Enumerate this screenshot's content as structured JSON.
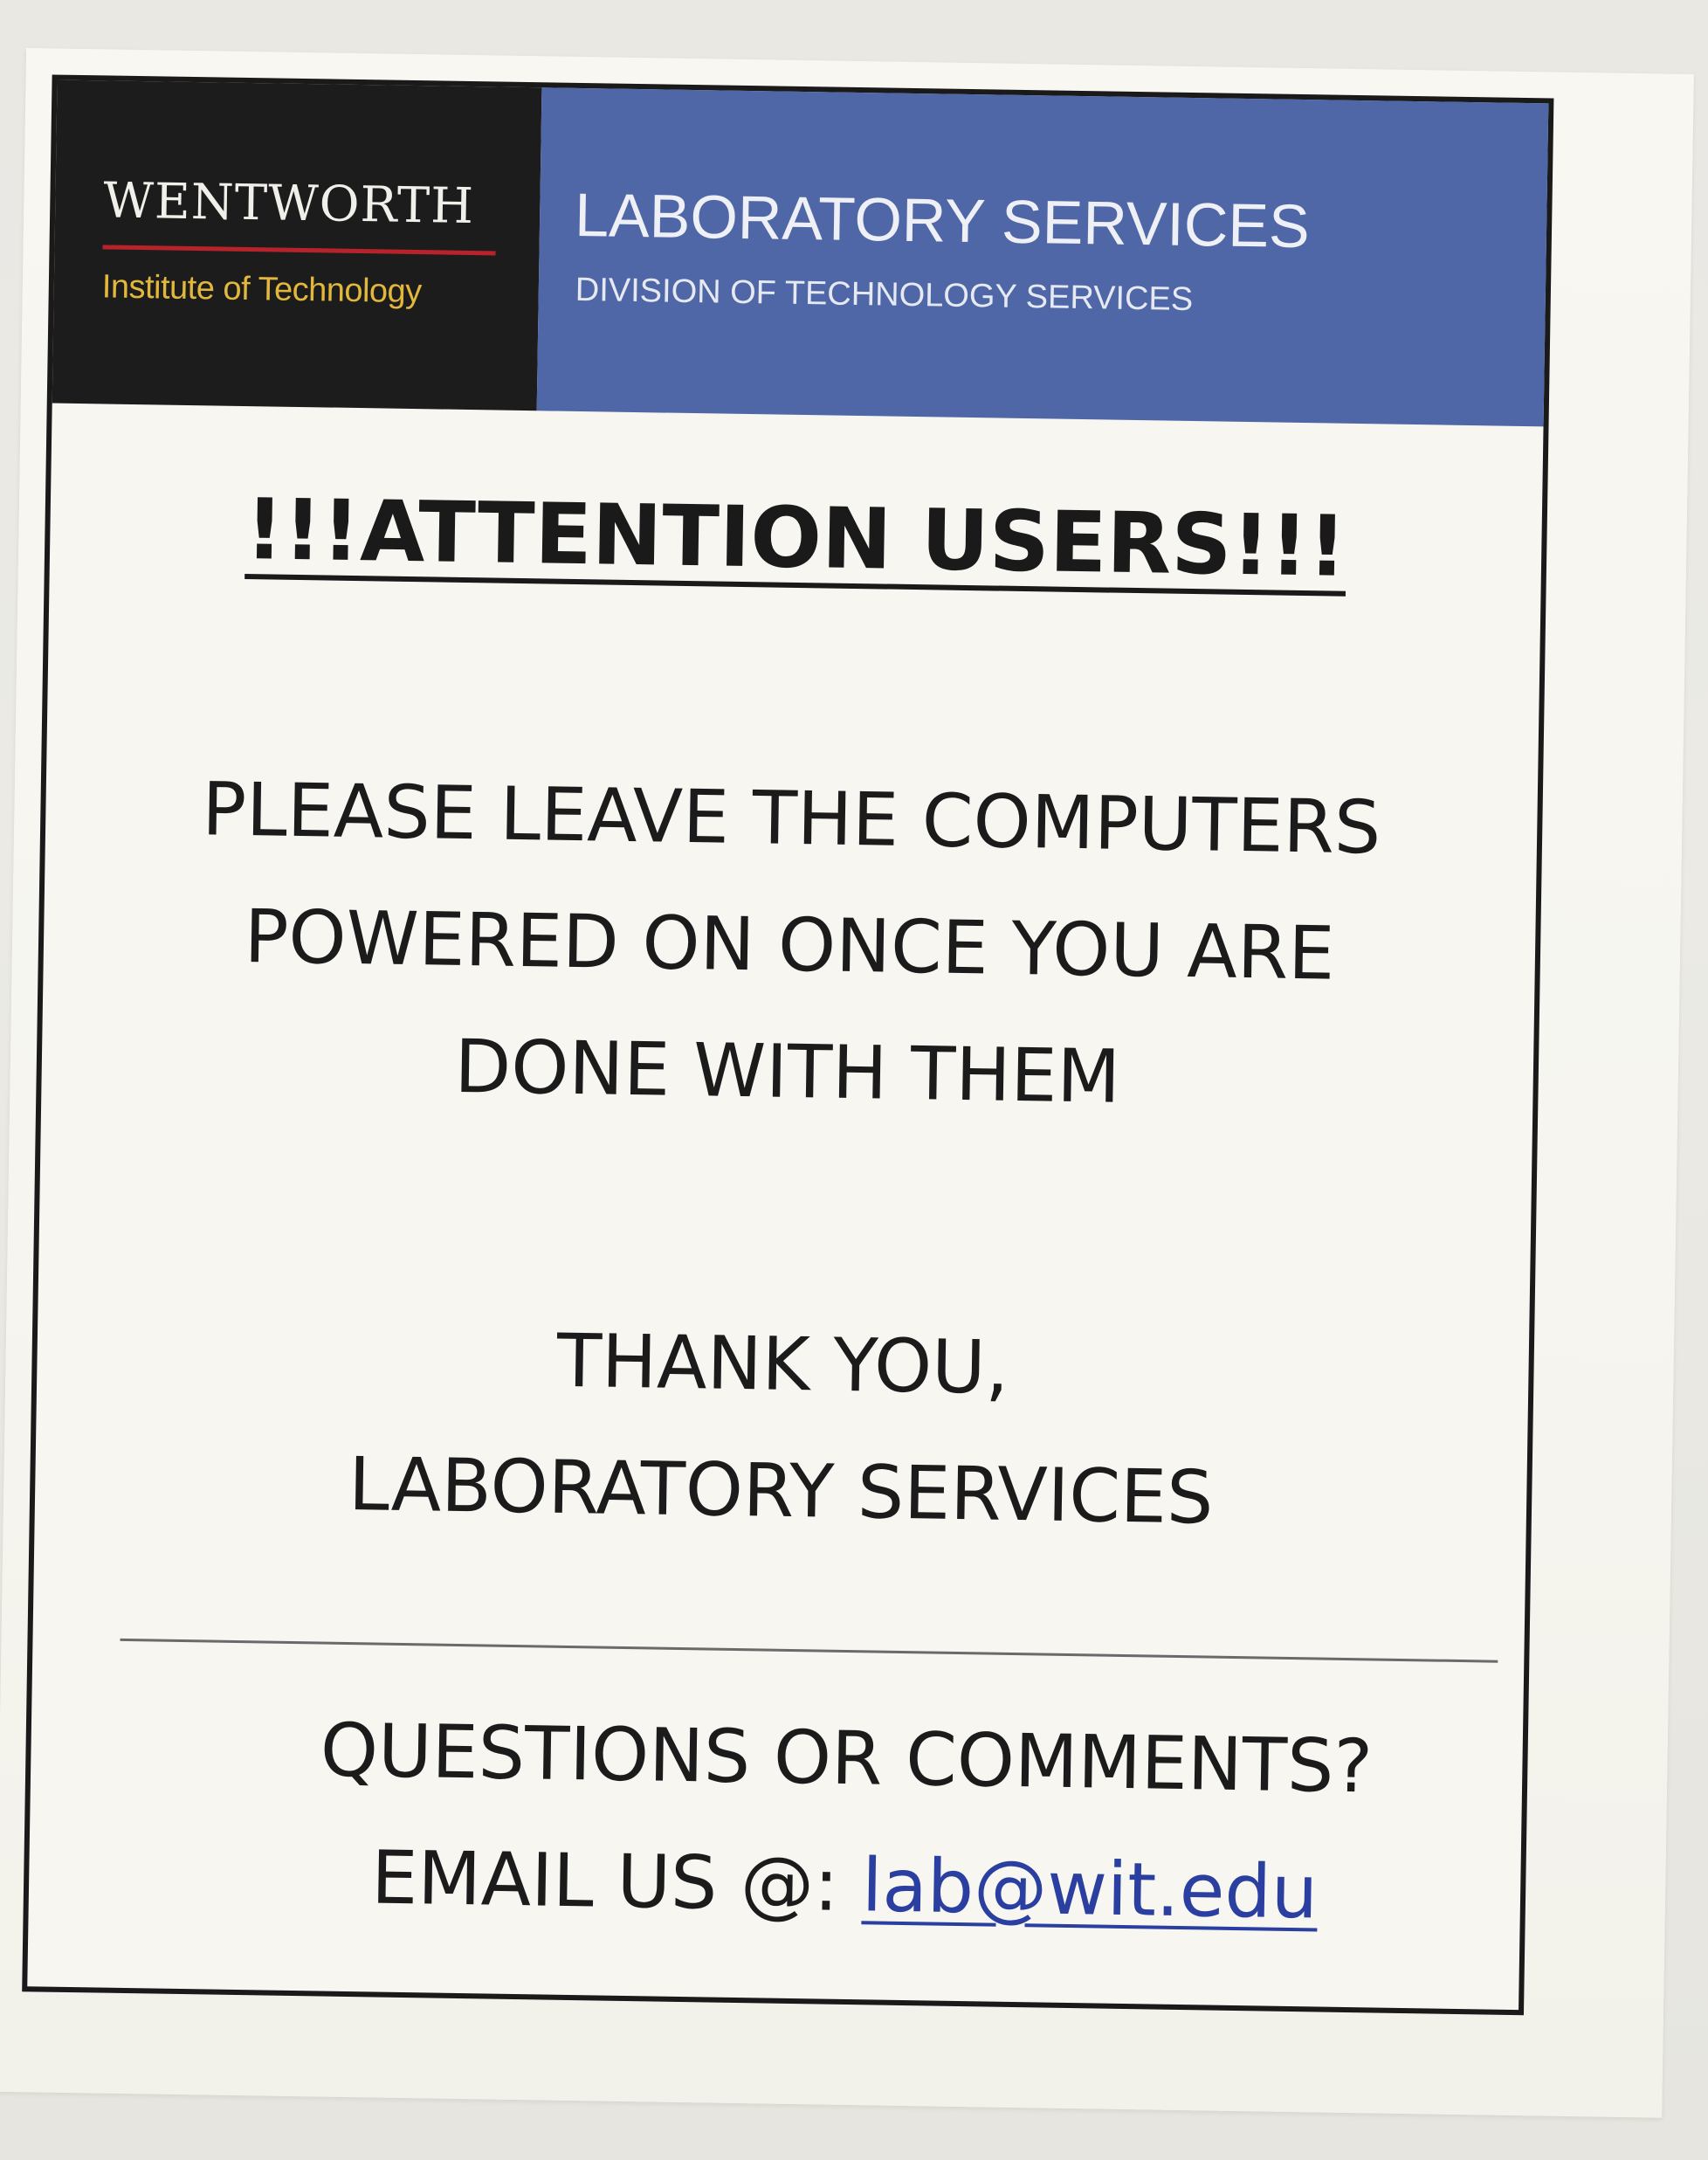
{
  "header": {
    "logo_name": "WENTWORTH",
    "logo_subtitle": "Institute of Technology",
    "department_title": "LABORATORY SERVICES",
    "department_subtitle": "DIVISION OF TECHNOLOGY SERVICES"
  },
  "notice": {
    "heading": "!!!ATTENTION USERS!!!",
    "message_lines": [
      "PLEASE LEAVE THE COMPUTERS",
      "POWERED ON ONCE YOU ARE",
      "DONE WITH THEM"
    ],
    "signoff_lines": [
      "THANK YOU,",
      "LABORATORY SERVICES"
    ]
  },
  "footer": {
    "question": "QUESTIONS OR COMMENTS?",
    "email_prefix": "EMAIL US @: ",
    "email_address": "lab@wit.edu"
  },
  "colors": {
    "banner_dark": "#1c1c1c",
    "banner_blue": "#4f67a6",
    "logo_gold": "#e2b83c",
    "logo_red_rule": "#b8232b",
    "link_blue": "#2a3fa0"
  }
}
